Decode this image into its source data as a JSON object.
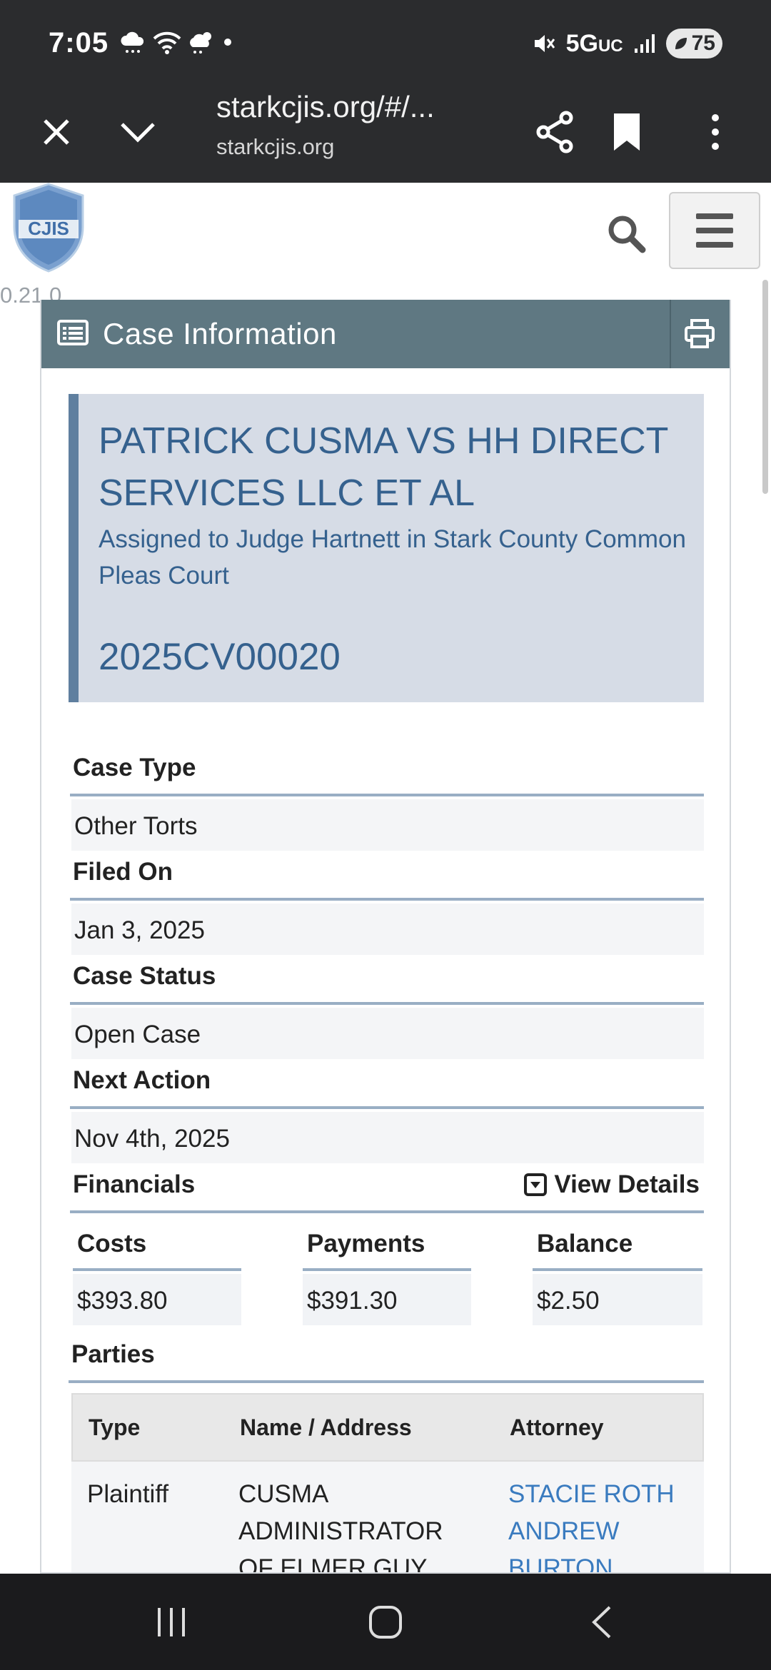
{
  "status_bar": {
    "time": "7:05",
    "network": "5G",
    "network_suffix": "UC",
    "battery": "75"
  },
  "browser": {
    "url_main": "starkcjis.org/#/...",
    "url_sub": "starkcjis.org"
  },
  "site": {
    "logo_text": "CJIS",
    "version": "0.21.0"
  },
  "card": {
    "title": "Case Information",
    "case_title": "PATRICK CUSMA VS HH DIRECT SERVICES LLC ET AL",
    "case_subtitle": "Assigned to Judge Hartnett in Stark County Common Pleas Court",
    "case_number": "2025CV00020",
    "fields": [
      {
        "label": "Case Type",
        "value": "Other Torts"
      },
      {
        "label": "Filed On",
        "value": "Jan 3, 2025"
      },
      {
        "label": "Case Status",
        "value": "Open Case"
      },
      {
        "label": "Next Action",
        "value": "Nov 4th, 2025"
      }
    ],
    "financials": {
      "label": "Financials",
      "view_details": "View Details",
      "costs_label": "Costs",
      "costs_value": "$393.80",
      "payments_label": "Payments",
      "payments_value": "$391.30",
      "balance_label": "Balance",
      "balance_value": "$2.50"
    },
    "parties": {
      "label": "Parties",
      "headers": [
        "Type",
        "Name / Address",
        "Attorney"
      ],
      "rows": [
        {
          "type": "Plaintiff",
          "name_lines": [
            "CUSMA",
            "ADMINISTRATOR",
            "OF ELMER GUY"
          ],
          "attorney_lines": [
            "STACIE ROTH",
            "ANDREW",
            "BURTON"
          ]
        }
      ]
    }
  },
  "colors": {
    "header_bar": "#2b2c2e",
    "card_header": "#5f7882",
    "banner_bg": "#d6dce6",
    "banner_text": "#35618e",
    "link": "#3a7bbf"
  }
}
